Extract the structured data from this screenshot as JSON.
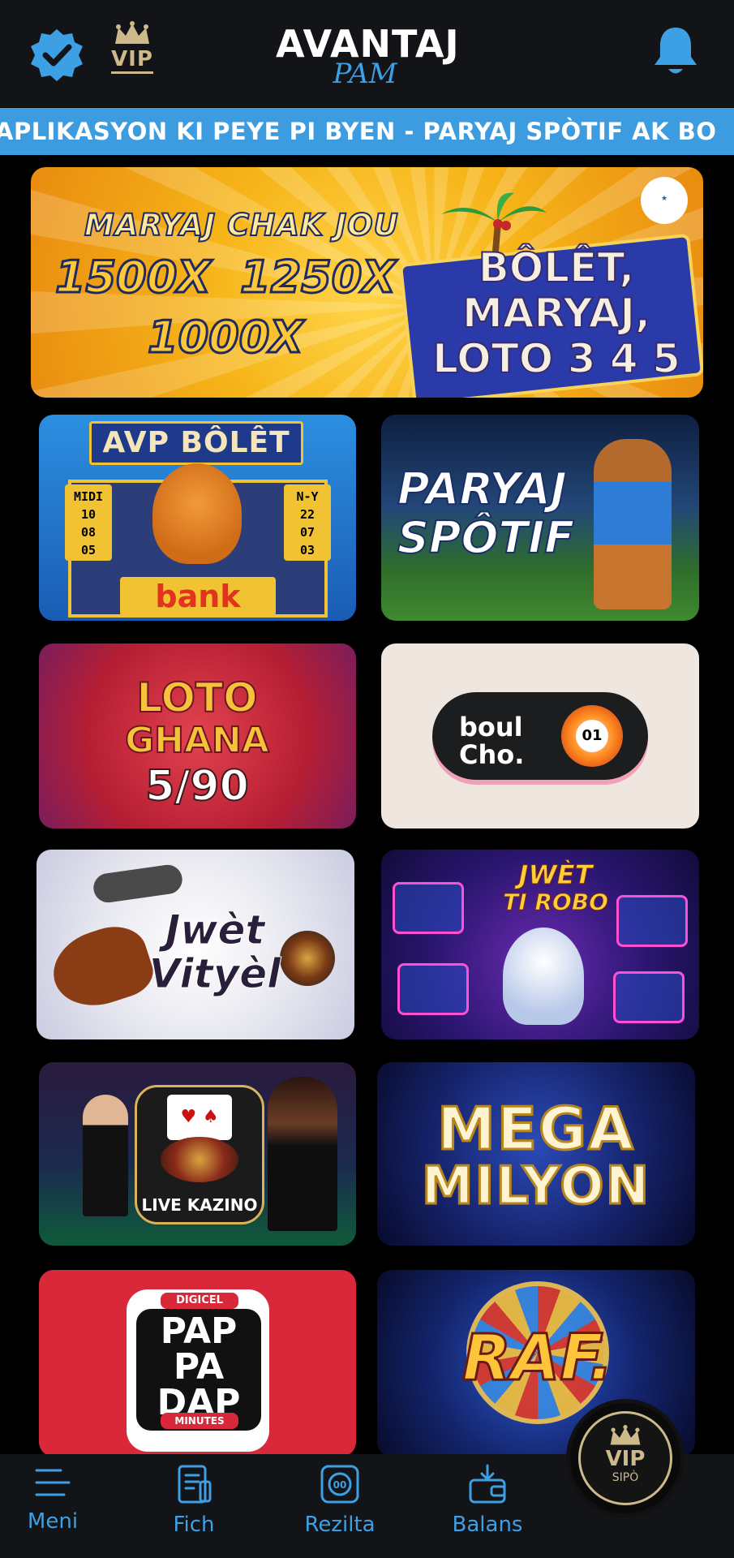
{
  "header": {
    "verified_icon": "verified-badge-icon",
    "vip_label": "VIP",
    "logo_line1": "AVANTAJ",
    "logo_line2": "PAM",
    "bell_icon": "bell-icon"
  },
  "ticker": {
    "text": "APLIKASYON KI PEYE PI BYEN - PARYAJ SPÒTIF AK BO"
  },
  "hero": {
    "title": "MARYAJ CHAK JOU",
    "mult1": "1500X",
    "mult2": "1250X",
    "mult3": "1000X",
    "sign_line1": "BÔLÊT,",
    "sign_line2": "MARYAJ,",
    "sign_line3": "LOTO 3 4 5"
  },
  "tiles": {
    "bolet": {
      "sign": "AVP BÔLÊT",
      "left_title": "MIDI",
      "left_nums": [
        "10",
        "08",
        "05"
      ],
      "right_title": "N-Y",
      "right_nums": [
        "22",
        "07",
        "03"
      ],
      "bank": "bank"
    },
    "sport": {
      "line1": "PARYAJ",
      "line2": "SPÔTIF"
    },
    "ghana": {
      "line1": "LOTO",
      "line2": "GHANA",
      "line3": "5/90"
    },
    "boul": {
      "line1": "boul",
      "line2": "Cho.",
      "ball": "01"
    },
    "vityel": {
      "line1": "Jwèt",
      "line2": "Vityèl"
    },
    "robo": {
      "line1": "JWÈT",
      "line2": "TI ROBO"
    },
    "kazino": {
      "label": "LIVE KAZINO"
    },
    "mega": {
      "line1": "MEGA",
      "line2": "MILYON"
    },
    "pap": {
      "brand": "DIGICEL",
      "line1": "PAP",
      "line2": "PA",
      "line3": "DAP",
      "sub": "MINUTES"
    },
    "raf": {
      "label": "RAF."
    }
  },
  "nav": {
    "items": [
      {
        "label": "Meni",
        "icon": "menu-icon"
      },
      {
        "label": "Fich",
        "icon": "ticket-icon"
      },
      {
        "label": "Rezilta",
        "icon": "results-icon"
      },
      {
        "label": "Balans",
        "icon": "wallet-icon"
      }
    ],
    "vip_label": "VIP",
    "vip_sub": "SIPÒ"
  },
  "colors": {
    "accent": "#3ea0e4",
    "header_bg": "#121418",
    "ticker_bg": "#3d9be0",
    "gold": "#cdb98a"
  }
}
